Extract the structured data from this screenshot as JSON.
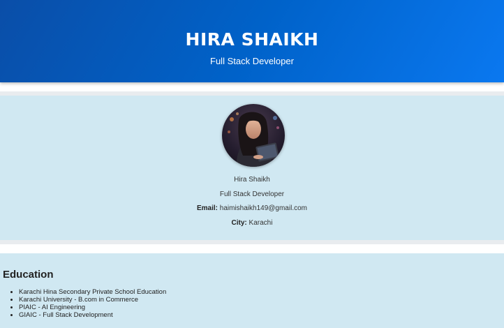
{
  "header": {
    "name": "HIRA SHAIKH",
    "title": "Full Stack Developer",
    "background": "#0062c9"
  },
  "profile": {
    "name": "Hira Shaikh",
    "role": "Full Stack Developer",
    "email_label": "Email:",
    "email": "haimishaikh149@gmail.com",
    "city_label": "City:",
    "city": "Karachi",
    "background": "#d0e8f2"
  },
  "education": {
    "heading": "Education",
    "items": [
      "Karachi Hina Secondary Private School Education",
      "Karachi University - B.com in Commerce",
      "PIAIC - AI Engineering",
      "GIAIC - Full Stack Development"
    ]
  }
}
